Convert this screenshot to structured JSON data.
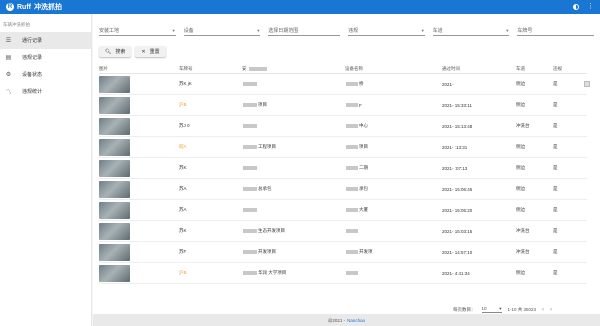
{
  "app": {
    "brand": "Ruff",
    "title": "冲洗抓拍"
  },
  "sidebar": {
    "section_title": "车辆冲洗抓拍",
    "items": [
      {
        "label": "通行记录",
        "icon": "list-icon",
        "active": true
      },
      {
        "label": "违规记录",
        "icon": "clipboard-icon",
        "active": false
      },
      {
        "label": "设备状态",
        "icon": "settings-sliders-icon",
        "active": false
      },
      {
        "label": "违规统计",
        "icon": "trend-icon",
        "active": false
      }
    ]
  },
  "filters": [
    {
      "placeholder": "安装工地"
    },
    {
      "placeholder": "设备"
    },
    {
      "placeholder": "选择日期范围"
    },
    {
      "placeholder": "违规"
    },
    {
      "placeholder": "车道"
    },
    {
      "placeholder": "车牌号"
    }
  ],
  "actions": {
    "search": "搜索",
    "reset": "重置"
  },
  "table": {
    "headers": [
      "图片",
      "车牌号",
      "安装工地",
      "设备名称",
      "通过时间",
      "车道",
      "违规"
    ],
    "rows": [
      {
        "plate": "苏K  jK",
        "plate_color": "normal",
        "site": "",
        "device": "桥",
        "time": "2021-",
        "lane": "侧边",
        "violation": "是"
      },
      {
        "plate": "沪B",
        "plate_color": "orange",
        "site": "项目",
        "device": "F",
        "time": "2021-  15:33:11",
        "lane": "侧边",
        "violation": "是"
      },
      {
        "plate": "苏J  0",
        "plate_color": "normal",
        "site": "",
        "device": "中心",
        "time": "2021-  15:13:48",
        "lane": "冲洗台",
        "violation": "是"
      },
      {
        "plate": "皖A",
        "plate_color": "orange",
        "site": "工程项目",
        "device": "项目",
        "time": "2021-  :13:31",
        "lane": "侧边",
        "violation": "是"
      },
      {
        "plate": "苏K",
        "plate_color": "normal",
        "site": "",
        "device": "二期",
        "time": "2021-  :07:13",
        "lane": "侧边",
        "violation": "是"
      },
      {
        "plate": "苏A",
        "plate_color": "normal",
        "site": "总承包",
        "device": "承包",
        "time": "2021-  15:06:45",
        "lane": "侧边",
        "violation": "是"
      },
      {
        "plate": "苏A",
        "plate_color": "normal",
        "site": "",
        "device": "大厦",
        "time": "2021-  15:05:20",
        "lane": "侧边",
        "violation": "是"
      },
      {
        "plate": "苏K",
        "plate_color": "normal",
        "site": "生态开发项目",
        "device": "",
        "time": "2021-  15:03:15",
        "lane": "冲洗台",
        "violation": "是"
      },
      {
        "plate": "苏F",
        "plate_color": "normal",
        "site": "开发项目",
        "device": "开发项",
        "time": "2021-  14:57:10",
        "lane": "冲洗台",
        "violation": "是"
      },
      {
        "plate": "沪B",
        "plate_color": "orange",
        "site": "华润  大学项目",
        "device": "",
        "time": "2021-  4:41:34",
        "lane": "侧边",
        "violation": "是"
      }
    ]
  },
  "pagination": {
    "rows_label": "每页数目：",
    "rows_value": "10",
    "range": "1-10 共 35023"
  },
  "footer": {
    "copyright": "@2021 -",
    "link": "Nanchao"
  },
  "colors": {
    "primary": "#1976d2",
    "orange_plate": "#f29b30"
  }
}
